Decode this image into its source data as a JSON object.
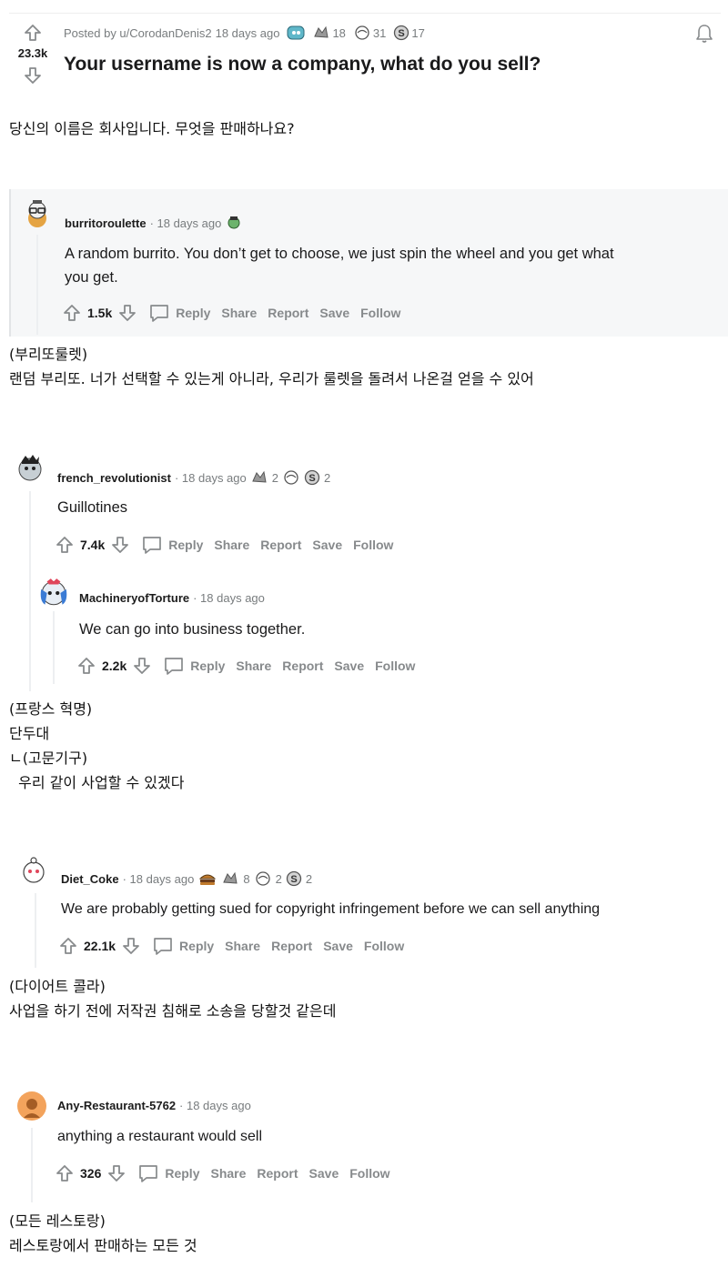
{
  "post": {
    "posted_by_prefix": "Posted by u/CorodanDenis2",
    "time": "18 days ago",
    "awards": [
      {
        "icon": "helpful-award-icon",
        "count": ""
      },
      {
        "icon": "wholesome-award-icon",
        "count": "18"
      },
      {
        "icon": "hugz-award-icon",
        "count": "31"
      },
      {
        "icon": "silver-award-icon",
        "count": "17"
      }
    ],
    "score": "23.3k",
    "title": "Your username is now a company, what do you sell?",
    "translation": "당신의 이름은 회사입니다. 무엇을 판매하나요?"
  },
  "actions": {
    "reply": "Reply",
    "share": "Share",
    "report": "Report",
    "save": "Save",
    "follow": "Follow"
  },
  "comments": [
    {
      "user": "burritoroulette",
      "time": "· 18 days ago",
      "text_lines": [
        "A random burrito. You don’t get to choose, we just spin the wheel and you get what",
        "you get."
      ],
      "score": "1.5k",
      "translation": [
        "(부리또룰렛)",
        "랜덤 부리또. 너가 선택할 수 있는게 아니라, 우리가 룰렛을 돌려서 나온걸 얻을 수 있어"
      ]
    },
    {
      "user": "french_revolutionist",
      "time": "· 18 days ago",
      "awards": [
        "2",
        "",
        "2"
      ],
      "text": "Guillotines",
      "score": "7.4k",
      "reply": {
        "user": "MachineryofTorture",
        "time": "· 18 days ago",
        "text": "We can go into business together.",
        "score": "2.2k"
      },
      "translation": [
        "(프랑스 혁명)",
        "단두대",
        "ㄴ(고문기구)",
        "  우리 같이 사업할 수 있겠다"
      ]
    },
    {
      "user": "Diet_Coke",
      "time": "· 18 days ago",
      "awards": [
        "",
        "8",
        "2",
        "2"
      ],
      "text": "We are probably getting sued for copyright infringement before we can sell anything",
      "score": "22.1k",
      "translation": [
        "(다이어트 콜라)",
        "사업을 하기 전에 저작권 침해로 소송을 당할것 같은데"
      ]
    },
    {
      "user": "Any-Restaurant-5762",
      "time": "· 18 days ago",
      "text": "anything a restaurant would sell",
      "score": "326",
      "translation": [
        "(모든 레스토랑)",
        "레스토랑에서 판매하는 모든 것"
      ]
    }
  ],
  "colors": {
    "meta": "#787c7e",
    "action": "#878a8c",
    "thread": "#edeff1",
    "panel": "#f6f7f8",
    "avatar_orange": "#f3a35c"
  }
}
